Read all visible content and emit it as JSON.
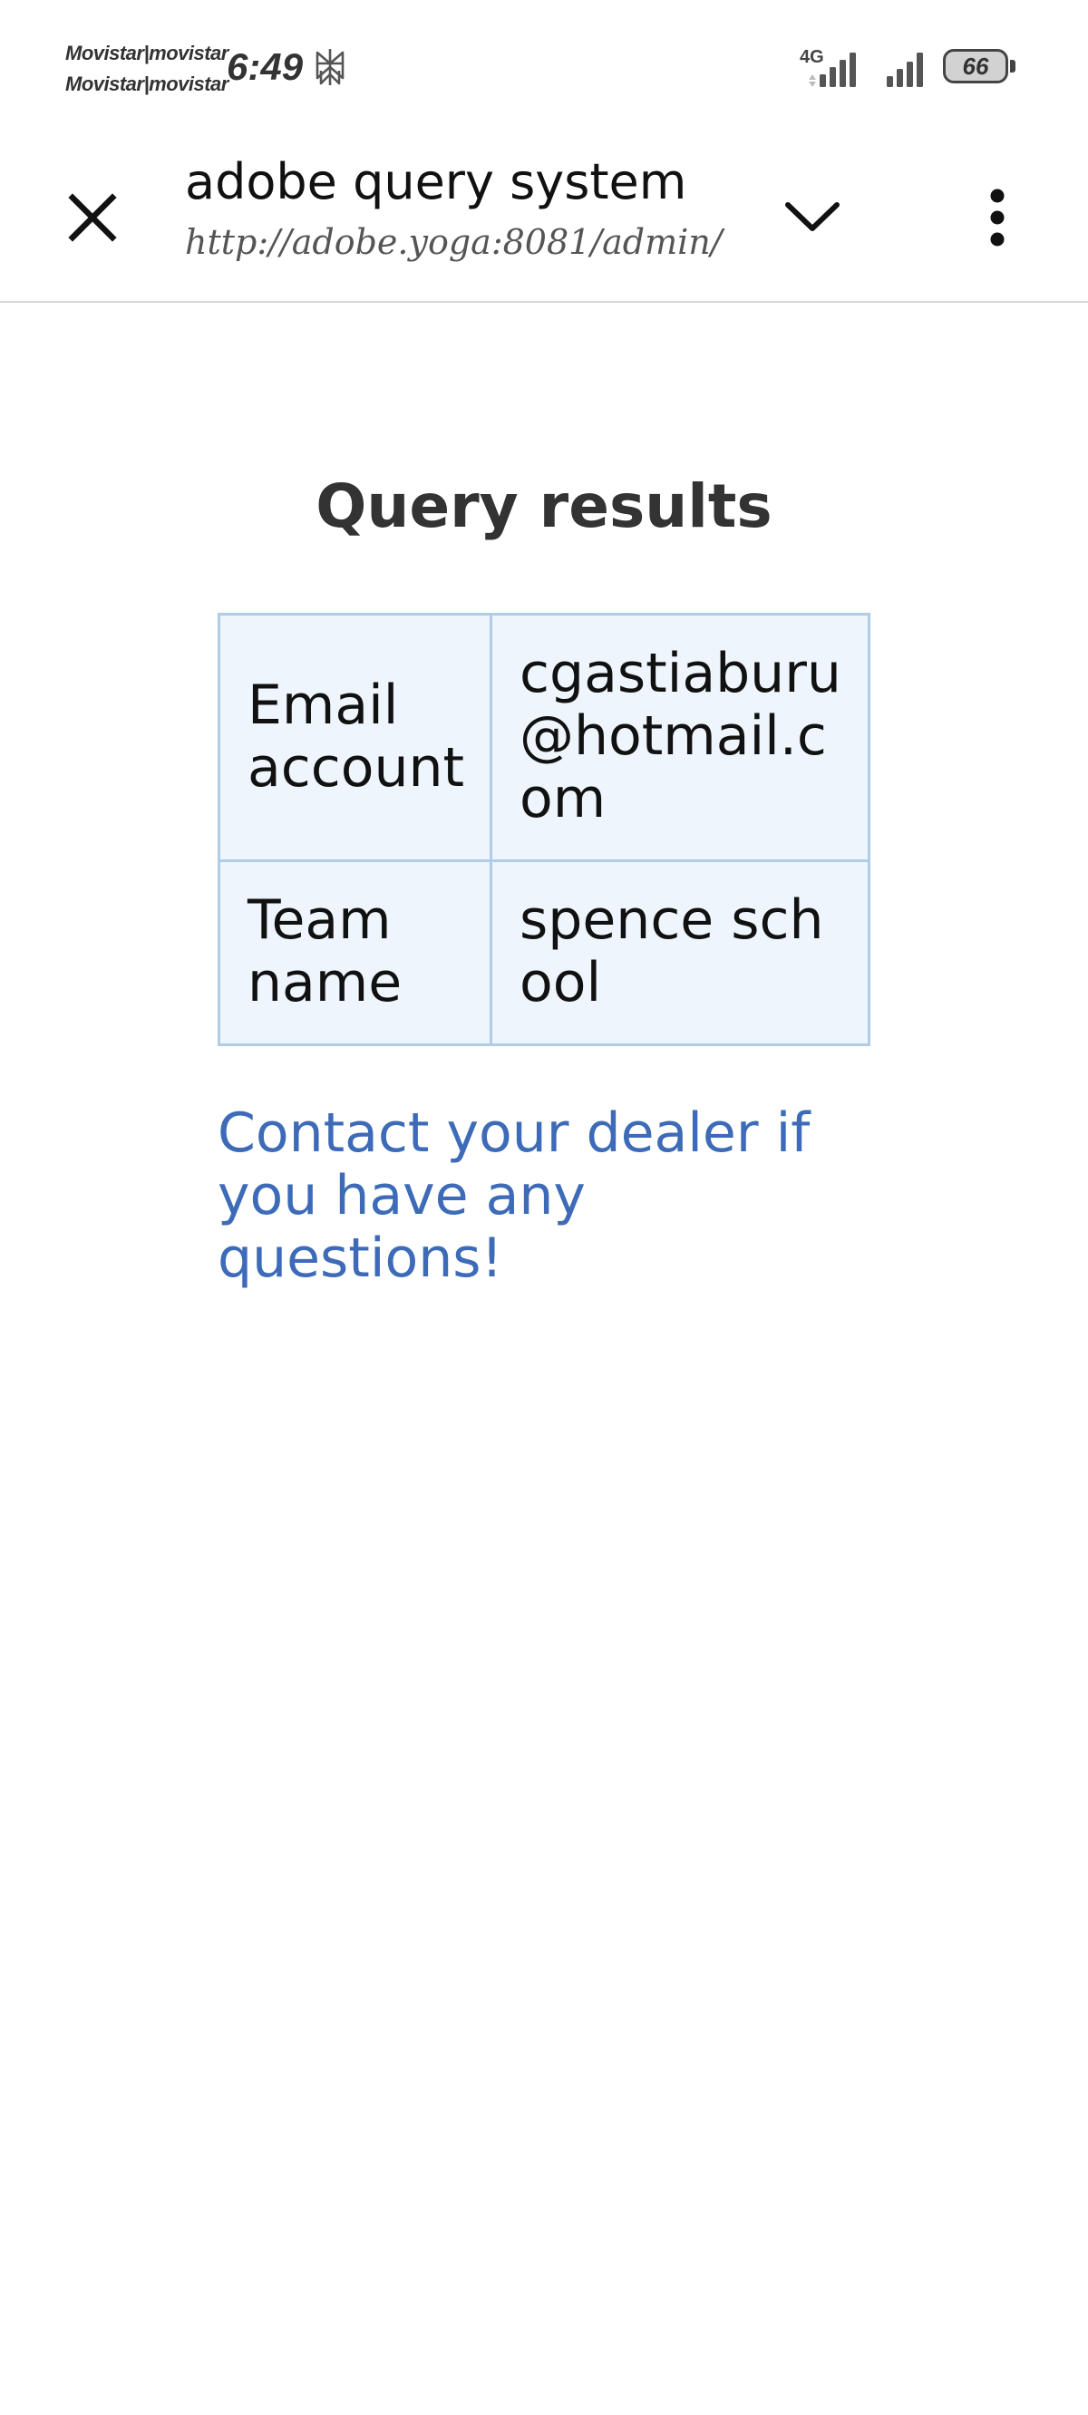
{
  "status_bar": {
    "carrier_line_1": "Movistar|movistar",
    "carrier_line_2": "Movistar|movistar",
    "time": "6:49",
    "status_icon": "perplexity-logo-icon",
    "network_type": "4G",
    "battery_level": "66"
  },
  "browser_header": {
    "title": "adobe query system",
    "url": "http://adobe.yoga:8081/admin/",
    "close_icon": "close-icon",
    "dropdown_icon": "chevron-down-icon",
    "menu_icon": "more-vertical-icon"
  },
  "page": {
    "heading": "Query results",
    "table": {
      "rows": [
        {
          "label": "Email account",
          "value": "cgastiaburu@hotmail.com"
        },
        {
          "label": "Team name",
          "value": "spence school"
        }
      ]
    },
    "contact_note": "Contact your dealer if you have any questions!"
  },
  "colors": {
    "table_background": "#eef5fc",
    "table_border": "#afcde6",
    "link_text": "#3d6bb8",
    "heading_text": "#333333"
  }
}
